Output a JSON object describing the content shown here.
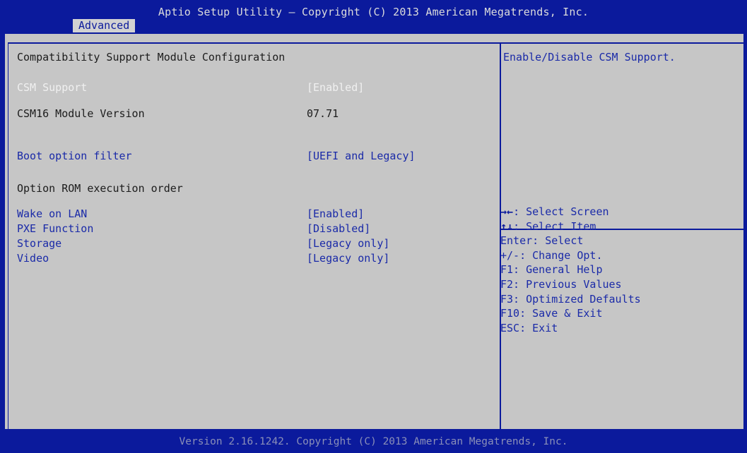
{
  "header": {
    "title": "Aptio Setup Utility – Copyright (C) 2013 American Megatrends, Inc.",
    "active_tab": "Advanced"
  },
  "section_title": "Compatibility Support Module Configuration",
  "settings": {
    "csm_support": {
      "label": "CSM Support",
      "value": "[Enabled]"
    },
    "csm16_version": {
      "label": "CSM16 Module Version",
      "value": "07.71"
    },
    "boot_option_filter": {
      "label": "Boot option filter",
      "value": "[UEFI and Legacy]"
    },
    "option_rom_heading": "Option ROM execution order",
    "wake_on_lan": {
      "label": "Wake on LAN",
      "value": "[Enabled]"
    },
    "pxe_function": {
      "label": "PXE Function",
      "value": "[Disabled]"
    },
    "storage": {
      "label": "Storage",
      "value": "[Legacy only]"
    },
    "video": {
      "label": "Video",
      "value": "[Legacy only]"
    }
  },
  "help_text": "Enable/Disable CSM Support.",
  "key_help": {
    "select_screen": {
      "keys": "→←",
      "text": ": Select Screen"
    },
    "select_item": {
      "keys": "↑↓",
      "text": ": Select Item"
    },
    "enter": "Enter: Select",
    "change": "+/-: Change Opt.",
    "f1": "F1: General Help",
    "f2": "F2: Previous Values",
    "f3": "F3: Optimized Defaults",
    "f10": "F10: Save & Exit",
    "esc": "ESC: Exit"
  },
  "footer": "Version 2.16.1242. Copyright (C) 2013 American Megatrends, Inc.",
  "colors": {
    "frame_blue": "#0b1a9c",
    "panel_grey": "#c6c6c6",
    "link_blue": "#1a2aa8",
    "highlight_white": "#f0f0f0"
  }
}
